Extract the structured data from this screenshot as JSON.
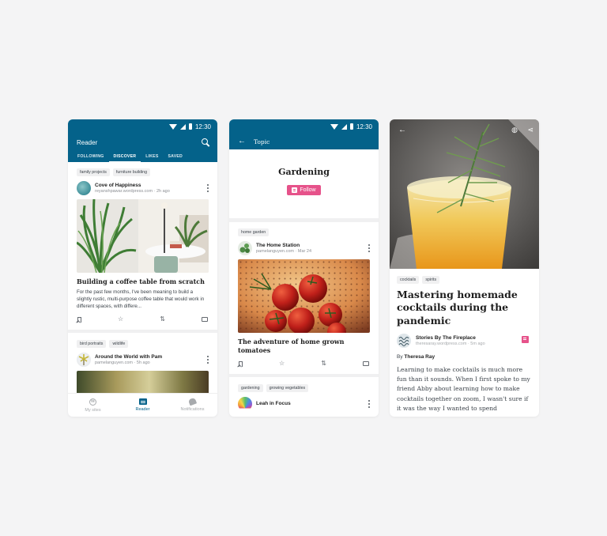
{
  "status_time": "12:30",
  "colors": {
    "brand": "#04628a",
    "accent": "#e6528a"
  },
  "screen1": {
    "title": "Reader",
    "tabs": [
      {
        "label": "FOLLOWING",
        "active": false
      },
      {
        "label": "DISCOVER",
        "active": true
      },
      {
        "label": "LIKES",
        "active": false
      },
      {
        "label": "SAVED",
        "active": false
      }
    ],
    "posts": [
      {
        "tags": [
          "family projects",
          "furniture building"
        ],
        "site": "Cove of Happiness",
        "meta": "reyanshpawar.wordpress.com · 2h ago",
        "title": "Building a coffee table from scratch",
        "excerpt": "For the past few months, I've been meaning to build a slightly rustic, multi-purpose coffee table that would work in different spaces, with differe..."
      },
      {
        "tags": [
          "bird portraits",
          "wildlife"
        ],
        "site": "Around the World with Pam",
        "meta": "pamelanguyen.com · 5h ago"
      }
    ],
    "nav": [
      {
        "label": "My sites",
        "icon": "wordpress-icon",
        "active": false
      },
      {
        "label": "Reader",
        "icon": "reader-icon",
        "active": true
      },
      {
        "label": "Notifications",
        "icon": "bell-icon",
        "active": false
      }
    ]
  },
  "screen2": {
    "title": "Topic",
    "topic": "Gardening",
    "follow_label": "Follow",
    "posts": [
      {
        "tags": [
          "home garden"
        ],
        "site": "The Home Station",
        "meta": "pamelanguyen.com · Mar 24",
        "title": "The adventure of home grown tomatoes"
      },
      {
        "tags": [
          "gardening",
          "growing vegetables"
        ],
        "site": "Leah in Focus"
      }
    ]
  },
  "screen3": {
    "tags": [
      "cocktails",
      "spirits"
    ],
    "title": "Mastering homemade cocktails during the pandemic",
    "site": "Stories By The Fireplace",
    "meta": "theresaray.wordpress.com · 5m ago",
    "byline_prefix": "By",
    "author": "Theresa Ray",
    "body": "Learning to make cocktails is much more fun than it sounds. When I first spoke to my friend Abby about learning how to make cocktails together on zoom, I wasn't sure if it was the way I wanted to spend"
  }
}
